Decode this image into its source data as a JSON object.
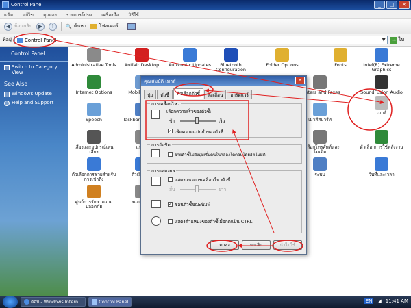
{
  "window": {
    "title": "Control Panel",
    "buttons": [
      "_",
      "□",
      "✕"
    ]
  },
  "menu": [
    "แฟ้ม",
    "แก้ไข",
    "มุมมอง",
    "รายการโปรด",
    "เครื่องมือ",
    "วิธีใช้"
  ],
  "toolbar": {
    "back_label": "ย้อนกลับ",
    "search_label": "ค้นหา",
    "folders_label": "โฟลเดอร์"
  },
  "address": {
    "label": "ที่อยู่",
    "value": "Control Panel",
    "go_label": "ไป"
  },
  "sidebar": {
    "title": "Control Panel",
    "switch_label": "Switch to Category View",
    "see_also": "See Also",
    "links": [
      "Windows Update",
      "Help and Support"
    ]
  },
  "icons": [
    {
      "label": "Administrative Tools",
      "color": "#8a8a8a"
    },
    {
      "label": "AntiVir Desktop",
      "color": "#d32020"
    },
    {
      "label": "Automatic Updates",
      "color": "#3a7ad6"
    },
    {
      "label": "Bluetooth Configuration",
      "color": "#1f4fb8"
    },
    {
      "label": "Folder Options",
      "color": "#e0b030"
    },
    {
      "label": "Fonts",
      "color": "#e0b030"
    },
    {
      "label": "Intel(R) Extreme Graphics",
      "color": "#3a7ad6"
    },
    {
      "label": "Internet Options",
      "color": "#2f8a3a"
    },
    {
      "label": "MobileMe Pr",
      "color": "#6e9bd1"
    },
    {
      "label": "Printers and Faxes",
      "color": "#777"
    },
    {
      "label": "SoundFusion Audio",
      "color": "#333"
    },
    {
      "label": "Speech",
      "color": "#6aa0d8"
    },
    {
      "label": "Taskbar an Menu",
      "color": "#4f7fc4"
    },
    {
      "label": "เมาส์",
      "color": "#bbbbbb"
    },
    {
      "label": "เมาส์สมาร์ท",
      "color": "#6aa0d8"
    },
    {
      "label": "เสียงและอุปกรณ์เล่นเสียง",
      "color": "#555"
    },
    {
      "label": "แป้นพ",
      "color": "#888"
    },
    {
      "label": "ตัวเลือกโทรศัพท์และโมเด็ม",
      "color": "#777"
    },
    {
      "label": "ตัวเลือกการใช้พลังงาน",
      "color": "#2f8a3a"
    },
    {
      "label": "ตัวเลือกการช่วยสำหรับการเข้าถึง",
      "color": "#3a7ad6"
    },
    {
      "label": "ตัวเลือกภูมิ",
      "color": "#3a7ad6"
    },
    {
      "label": "ระบบ",
      "color": "#4f7fc4"
    },
    {
      "label": "วันที่และเวลา",
      "color": "#3a7ad6"
    },
    {
      "label": "ศูนย์การรักษาความปลอดภัย",
      "color": "#d08020"
    },
    {
      "label": "สแกนเนอร์",
      "color": "#888"
    }
  ],
  "dialog": {
    "title": "คุณสมบัติ เมาส์",
    "tabs": [
      "ปุ่ม",
      "ตัวชี้",
      "ตัวเลือกตัวชี้",
      "ล้อเลื่อน",
      "ฮาร์ดแวร์"
    ],
    "motion": {
      "label": "การเคลื่อนไหว",
      "speed_label": "เลือกความเร็วของตัวชี้:",
      "slow": "ช้า",
      "fast": "เร็ว",
      "precision_label": "เพิ่มความแม่นยำของตัวชี้"
    },
    "snap": {
      "label": "การจัดชิด",
      "option": "ย้ายตัวชี้ไปยังปุ่มเริ่มต้นในกล่องโต้ตอบโดยอัตโนมัติ"
    },
    "visibility": {
      "label": "การแสดงผล",
      "trails_label": "แสดงแนวการเคลื่อนไหวตัวชี้",
      "short": "สั้น",
      "long": "ยาว",
      "hide_label": "ซ่อนตัวชี้ขณะพิมพ์",
      "ctrl_label": "แสดงตำแหน่งของตัวชี้เมื่อกดแป้น CTRL"
    },
    "buttons": [
      "ตกลง",
      "ยกเลิก",
      "นำไปใช้"
    ]
  },
  "taskbar": {
    "tasks": [
      "ตอบ - Windows Intern...",
      "Control Panel"
    ],
    "lang": "EN",
    "time": "11:41 AM"
  },
  "accent": "#e02020"
}
